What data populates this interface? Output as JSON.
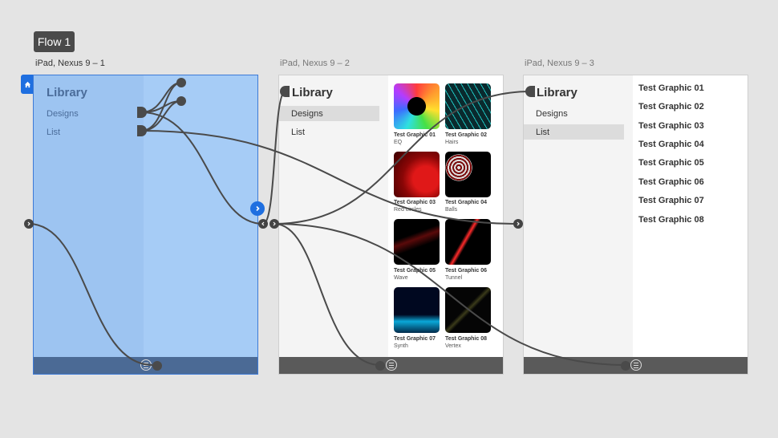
{
  "flow_badge": "Flow 1",
  "artboards": [
    {
      "label": "iPad, Nexus 9 – 1",
      "title": "Library",
      "items": [
        "Designs",
        "List"
      ]
    },
    {
      "label": "iPad, Nexus 9 – 2",
      "title": "Library",
      "items": [
        "Designs",
        "List"
      ],
      "active_item": "Designs"
    },
    {
      "label": "iPad, Nexus 9 – 3",
      "title": "Library",
      "items": [
        "Designs",
        "List"
      ],
      "active_item": "List"
    }
  ],
  "graphics": [
    {
      "title": "Test Graphic 01",
      "sub": "EQ"
    },
    {
      "title": "Test Graphic 02",
      "sub": "Hairs"
    },
    {
      "title": "Test Graphic 03",
      "sub": "Red circles"
    },
    {
      "title": "Test Graphic 04",
      "sub": "Balls"
    },
    {
      "title": "Test Graphic 05",
      "sub": "Wave"
    },
    {
      "title": "Test Graphic 06",
      "sub": "Tunnel"
    },
    {
      "title": "Test Graphic 07",
      "sub": "Synth"
    },
    {
      "title": "Test Graphic 08",
      "sub": "Vertex"
    }
  ],
  "list_rows": [
    "Test Graphic 01",
    "Test Graphic 02",
    "Test Graphic 03",
    "Test Graphic 04",
    "Test Graphic 05",
    "Test Graphic 06",
    "Test Graphic 07",
    "Test Graphic 08"
  ],
  "icons": [
    "home-icon",
    "menu-icon",
    "chevron-right-icon",
    "chevron-left-icon"
  ],
  "colors": {
    "selection": "#1f6fe0",
    "wire": "#4a4a4a",
    "canvas": "#e4e4e4"
  }
}
